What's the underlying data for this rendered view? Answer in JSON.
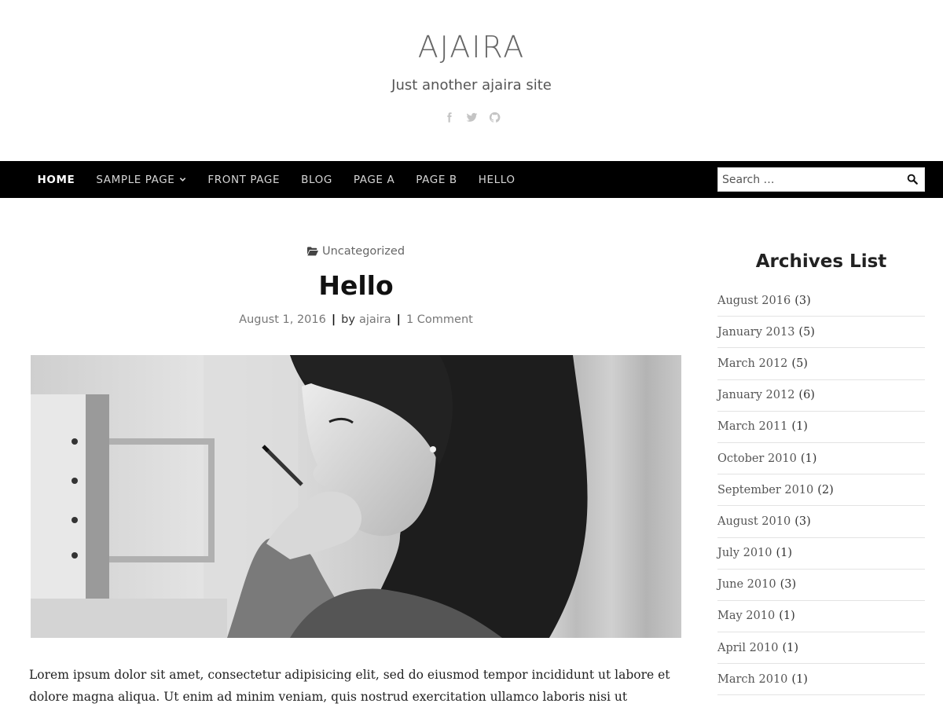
{
  "site": {
    "title": "AJAIRA",
    "tagline": "Just another ajaira site",
    "social_icons": [
      "facebook-icon",
      "twitter-icon",
      "github-icon"
    ]
  },
  "nav": {
    "items": [
      {
        "label": "HOME",
        "active": true
      },
      {
        "label": "SAMPLE PAGE",
        "has_dropdown": true
      },
      {
        "label": "FRONT PAGE"
      },
      {
        "label": "BLOG"
      },
      {
        "label": "PAGE A"
      },
      {
        "label": "PAGE B"
      },
      {
        "label": "HELLO"
      }
    ]
  },
  "search": {
    "placeholder": "Search …",
    "icon": "search-icon"
  },
  "post": {
    "category": "Uncategorized",
    "title": "Hello",
    "date": "August 1, 2016",
    "by_label": "by",
    "author": "ajaira",
    "comments": "1 Comment",
    "excerpt": "Lorem ipsum dolor sit amet, consectetur adipisicing elit, sed do eiusmod tempor incididunt ut labore et dolore magna aliqua. Ut enim ad minim veniam, quis nostrud exercitation ullamco laboris nisi ut"
  },
  "sidebar": {
    "archives_title": "Archives List",
    "archives": [
      {
        "month": "August 2016",
        "count": "(3)"
      },
      {
        "month": "January 2013",
        "count": "(5)"
      },
      {
        "month": "March 2012",
        "count": "(5)"
      },
      {
        "month": "January 2012",
        "count": "(6)"
      },
      {
        "month": "March 2011",
        "count": "(1)"
      },
      {
        "month": "October 2010",
        "count": "(1)"
      },
      {
        "month": "September 2010",
        "count": "(2)"
      },
      {
        "month": "August 2010",
        "count": "(3)"
      },
      {
        "month": "July 2010",
        "count": "(1)"
      },
      {
        "month": "June 2010",
        "count": "(3)"
      },
      {
        "month": "May 2010",
        "count": "(1)"
      },
      {
        "month": "April 2010",
        "count": "(1)"
      },
      {
        "month": "March 2010",
        "count": "(1)"
      }
    ]
  },
  "colors": {
    "nav_bg": "#000000",
    "nav_text": "#d6d6d6",
    "accent_text": "#111111"
  }
}
